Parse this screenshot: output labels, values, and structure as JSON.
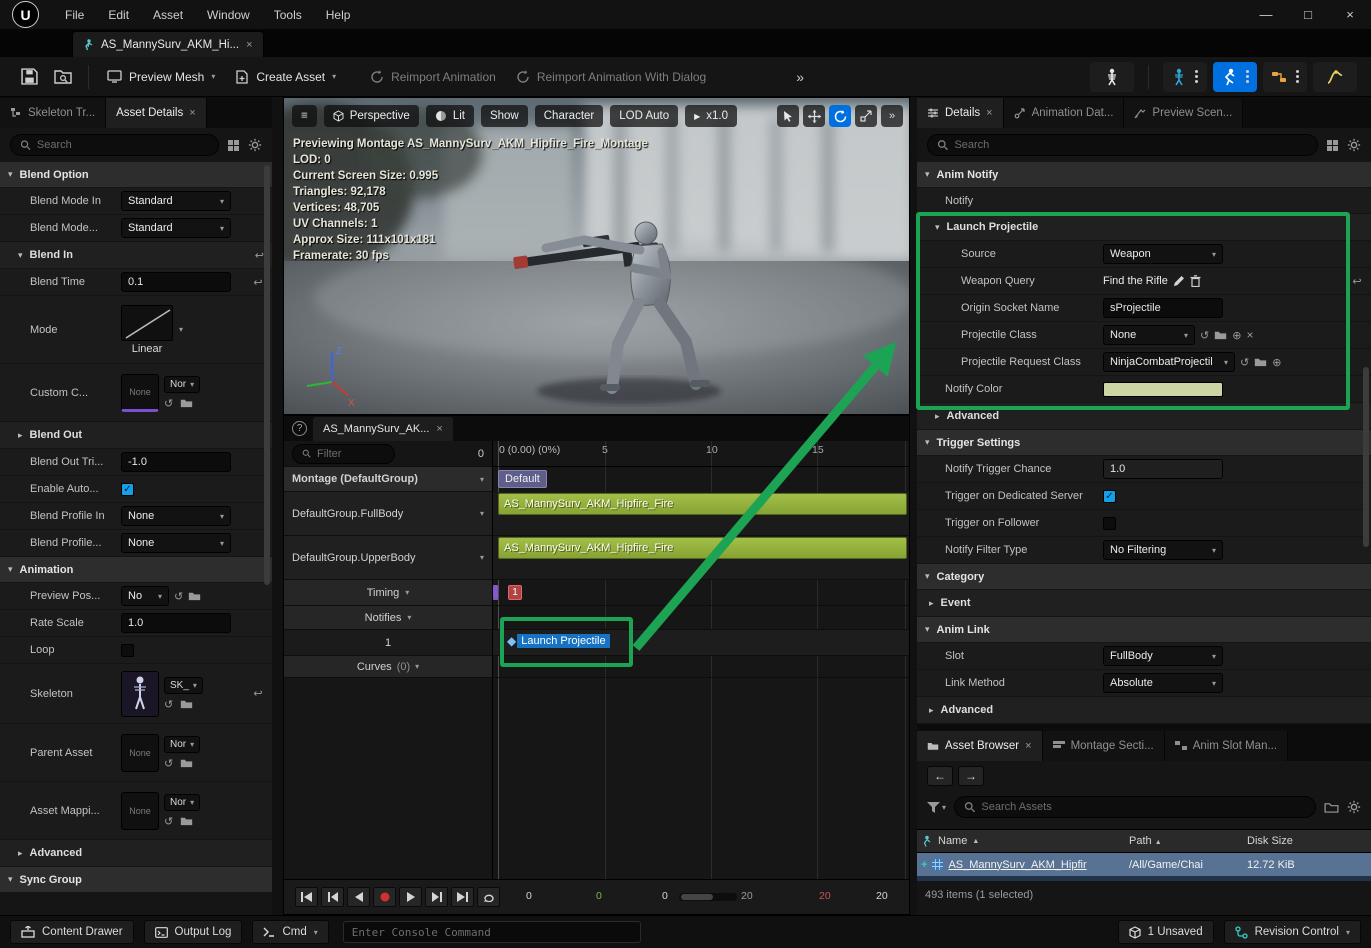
{
  "colors": {
    "accent_blue": "#0070e0",
    "highlight_teal": "#26bbff",
    "annotation_green": "#1ca353",
    "montage_bar_green": "#94b13d",
    "notify_color_swatch": "#ccd6a4",
    "selected_row_blue": "#587294"
  },
  "menubar": {
    "items": [
      "File",
      "Edit",
      "Asset",
      "Window",
      "Tools",
      "Help"
    ],
    "minimize": "—",
    "maximize": "□",
    "close": "×"
  },
  "asset_tab": {
    "label": "AS_MannySurv_AKM_Hi...",
    "close": "×"
  },
  "toolbar": {
    "preview_mesh": "Preview Mesh",
    "create_asset": "Create Asset",
    "reimport": "Reimport Animation",
    "reimport_dialog": "Reimport Animation With Dialog",
    "overflow": "»"
  },
  "left": {
    "tab_skeleton_tree": "Skeleton Tr...",
    "tab_asset_details": "Asset Details",
    "tab_close": "×",
    "search_placeholder": "Search",
    "blend_option_header": "Blend Option",
    "blend_mode_in": {
      "label": "Blend Mode In",
      "value": "Standard"
    },
    "blend_mode_out": {
      "label": "Blend Mode...",
      "value": "Standard"
    },
    "blend_in_header": "Blend In",
    "blend_time": {
      "label": "Blend Time",
      "value": "0.1"
    },
    "mode": {
      "label": "Mode",
      "value": "Linear"
    },
    "custom_curve": {
      "label": "Custom C...",
      "thumb": "None",
      "value": "Nor"
    },
    "blend_out_header": "Blend Out",
    "blend_out_trigger": {
      "label": "Blend Out Tri...",
      "value": "-1.0"
    },
    "enable_auto_label": "Enable Auto...",
    "blend_profile_in": {
      "label": "Blend Profile In",
      "value": "None"
    },
    "blend_profile_out": {
      "label": "Blend Profile...",
      "value": "None"
    },
    "animation_header": "Animation",
    "preview_pose": {
      "label": "Preview Pos...",
      "value": "No"
    },
    "rate_scale": {
      "label": "Rate Scale",
      "value": "1.0"
    },
    "loop_label": "Loop",
    "skeleton": {
      "label": "Skeleton",
      "value": "SK_"
    },
    "parent_asset": {
      "label": "Parent Asset",
      "thumb": "None",
      "value": "Nor"
    },
    "asset_mapping": {
      "label": "Asset Mappi...",
      "thumb": "None",
      "value": "Nor"
    },
    "advanced_header": "Advanced",
    "sync_group_header": "Sync Group"
  },
  "viewport": {
    "menu_icon": "≡",
    "perspective": "Perspective",
    "lit": "Lit",
    "show": "Show",
    "character": "Character",
    "lod": "LOD Auto",
    "speed": "x1.0",
    "overflow": "»",
    "stats": [
      "Previewing Montage AS_MannySurv_AKM_Hipfire_Fire_Montage",
      "LOD: 0",
      "Current Screen Size: 0.995",
      "Triangles: 92,178",
      "Vertices: 48,705",
      "UV Channels: 1",
      "Approx Size: 111x101x181",
      "Framerate: 30 fps"
    ],
    "gizmo_z": "Z",
    "gizmo_x": "X"
  },
  "timeline": {
    "tab": "AS_MannySurv_AK...",
    "tab_close": "×",
    "filter_placeholder": "Filter",
    "count": "0",
    "ruler_label": "0 (0.00) (0%)",
    "ticks": [
      "5",
      "10",
      "15"
    ],
    "montage_group": "Montage (DefaultGroup)",
    "fullbody": "DefaultGroup.FullBody",
    "upperbody": "DefaultGroup.UpperBody",
    "timing": "Timing",
    "notifies": "Notifies",
    "notify_track": "1",
    "curves": "Curves",
    "curves_count": "(0)",
    "section_label": "Default",
    "clip_label": "AS_MannySurv_AKM_Hipfire_Fire",
    "timing_marker": "1",
    "notify_label": "Launch Projectile",
    "transport": {
      "r1": "0",
      "r2": "0",
      "r3": "0",
      "r4": "20",
      "r5": "20",
      "r6": "20"
    }
  },
  "details": {
    "tab_details": "Details",
    "tab_close": "×",
    "tab_anim_data": "Animation Dat...",
    "tab_preview_scene": "Preview Scen...",
    "search_placeholder": "Search",
    "anim_notify_header": "Anim Notify",
    "notify_label": "Notify",
    "launch": {
      "header": "Launch Projectile",
      "source_label": "Source",
      "source_value": "Weapon",
      "weapon_query_label": "Weapon Query",
      "weapon_query_value": "Find the Rifle",
      "origin_label": "Origin Socket Name",
      "origin_value": "sProjectile",
      "proj_class_label": "Projectile Class",
      "proj_class_value": "None",
      "proj_req_label": "Projectile Request Class",
      "proj_req_value": "NinjaCombatProjectil"
    },
    "notify_color_label": "Notify Color",
    "advanced_header": "Advanced",
    "trigger_header": "Trigger Settings",
    "trigger_chance_label": "Notify Trigger Chance",
    "trigger_chance_value": "1.0",
    "dedicated_label": "Trigger on Dedicated Server",
    "follower_label": "Trigger on Follower",
    "filter_type_label": "Notify Filter Type",
    "filter_type_value": "No Filtering",
    "category_header": "Category",
    "event_header": "Event",
    "anim_link_header": "Anim Link",
    "slot_label": "Slot",
    "slot_value": "FullBody",
    "link_method_label": "Link Method",
    "link_method_value": "Absolute",
    "advanced2_header": "Advanced"
  },
  "assets": {
    "tab_browser": "Asset Browser",
    "tab_close": "×",
    "tab_montage": "Montage Secti...",
    "tab_slot": "Anim Slot Man...",
    "search_placeholder": "Search Assets",
    "col_name": "Name",
    "col_path": "Path",
    "col_size": "Disk Size",
    "row": {
      "name": "AS_MannySurv_AKM_Hipfir",
      "path": "/All/Game/Chai",
      "size": "12.72 KiB"
    },
    "status": "493 items (1 selected)"
  },
  "statusbar": {
    "content_drawer": "Content Drawer",
    "output_log": "Output Log",
    "cmd": "Cmd",
    "console_placeholder": "Enter Console Command",
    "unsaved": "1 Unsaved",
    "revision": "Revision Control"
  }
}
